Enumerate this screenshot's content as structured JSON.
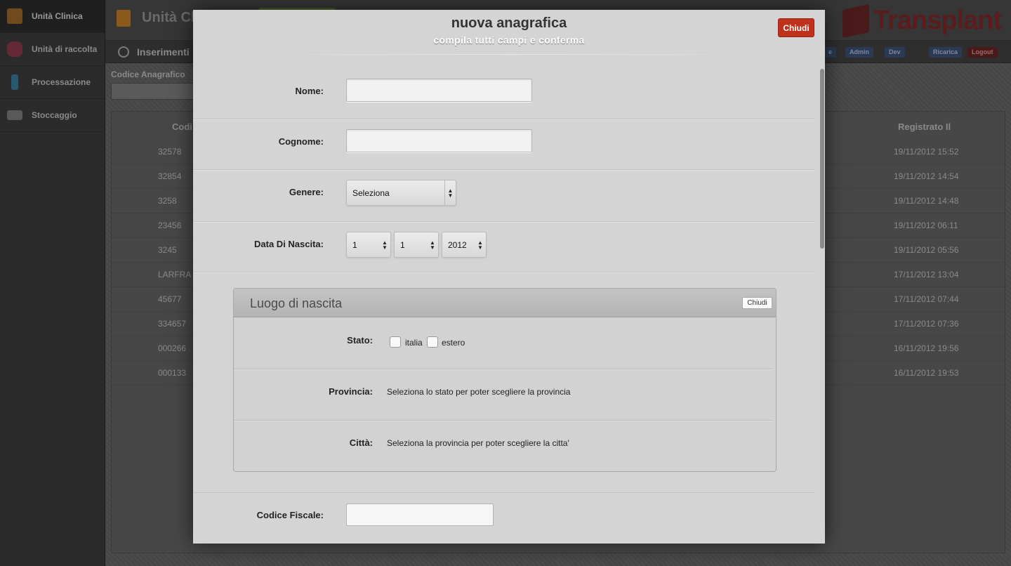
{
  "sidebar": {
    "items": [
      {
        "label": "Unità Clinica",
        "icon": "clipboard-icon",
        "color": "#8a5a1c"
      },
      {
        "label": "Unità di raccolta",
        "icon": "blood-bag-icon",
        "color": "#7a2a3a"
      },
      {
        "label": "Processazione",
        "icon": "test-tube-icon",
        "color": "#2a6a8a"
      },
      {
        "label": "Stoccaggio",
        "icon": "tray-icon",
        "color": "#6a6a6a"
      }
    ]
  },
  "header": {
    "title": "Unità Cl",
    "logo": "Transplant"
  },
  "subheader": {
    "title": "Inserimenti",
    "buttons": {
      "partial": "e",
      "admin": "Admin",
      "dev": "Dev",
      "ricarica": "Ricarica",
      "logout": "Logout"
    }
  },
  "search": {
    "label": "Codice Anagrafico"
  },
  "table": {
    "headers": {
      "code": "Codi",
      "registered": "Registrato Il"
    },
    "rows": [
      {
        "code": "32578",
        "date": "19/11/2012 15:52"
      },
      {
        "code": "32854",
        "date": "19/11/2012 14:54"
      },
      {
        "code": "3258",
        "date": "19/11/2012 14:48"
      },
      {
        "code": "23456",
        "date": "19/11/2012 06:11"
      },
      {
        "code": "3245",
        "date": "19/11/2012 05:56"
      },
      {
        "code": "LARFRA",
        "date": "17/11/2012 13:04"
      },
      {
        "code": "45677",
        "date": "17/11/2012 07:44"
      },
      {
        "code": "334657",
        "date": "17/11/2012 07:36"
      },
      {
        "code": "000266",
        "date": "16/11/2012 19:56"
      },
      {
        "code": "000133",
        "date": "16/11/2012 19:53"
      }
    ]
  },
  "modal": {
    "title": "nuova anagrafica",
    "subtitle": "compila tutti campi e conferma",
    "close_label": "Chiudi",
    "fields": {
      "nome": {
        "label": "Nome:",
        "value": ""
      },
      "cognome": {
        "label": "Cognome:",
        "value": ""
      },
      "genere": {
        "label": "Genere:",
        "selected": "Seleziona"
      },
      "nascita": {
        "label": "Data Di Nascita:",
        "day": "1",
        "month": "1",
        "year": "2012"
      },
      "codice_fiscale": {
        "label": "Codice Fiscale:",
        "value": ""
      }
    },
    "luogo": {
      "title": "Luogo di nascita",
      "close_label": "Chiudi",
      "stato": {
        "label": "Stato:",
        "options": [
          "italia",
          "estero"
        ]
      },
      "provincia": {
        "label": "Provincia:",
        "text": "Seleziona lo stato per poter scegliere la provincia"
      },
      "citta": {
        "label": "Città:",
        "text": "Seleziona la provincia per poter scegliere la citta'"
      }
    }
  }
}
